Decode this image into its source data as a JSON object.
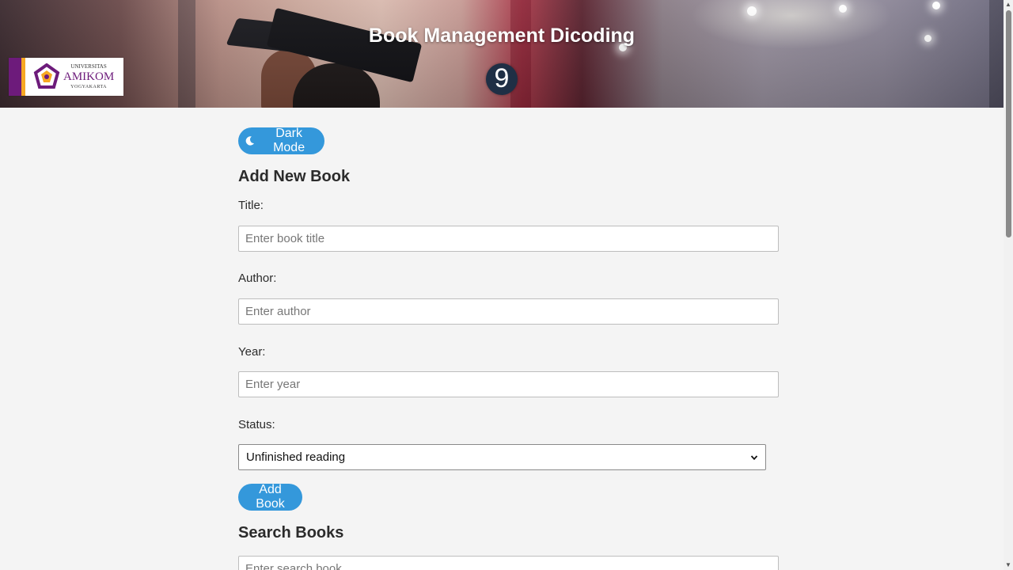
{
  "header": {
    "title": "Book Management Dicoding",
    "badge": "9",
    "logo": {
      "line1": "UNIVERSITAS",
      "line2": "AMIKOM",
      "line3": "YOGYAKARTA"
    }
  },
  "toolbar": {
    "dark_mode_label": "Dark Mode"
  },
  "form": {
    "heading": "Add New Book",
    "title_label": "Title:",
    "title_placeholder": "Enter book title",
    "author_label": "Author:",
    "author_placeholder": "Enter author",
    "year_label": "Year:",
    "year_placeholder": "Enter year",
    "status_label": "Status:",
    "status_selected": "Unfinished reading",
    "submit_label": "Add Book"
  },
  "search": {
    "heading": "Search Books",
    "placeholder": "Enter search book"
  },
  "colors": {
    "accent": "#3498db",
    "background": "#f4f4f4",
    "brand_purple": "#6d1b7b",
    "brand_orange": "#f7a823"
  },
  "icons": {
    "dark_mode": "moon-icon",
    "select": "chevron-down-icon"
  }
}
